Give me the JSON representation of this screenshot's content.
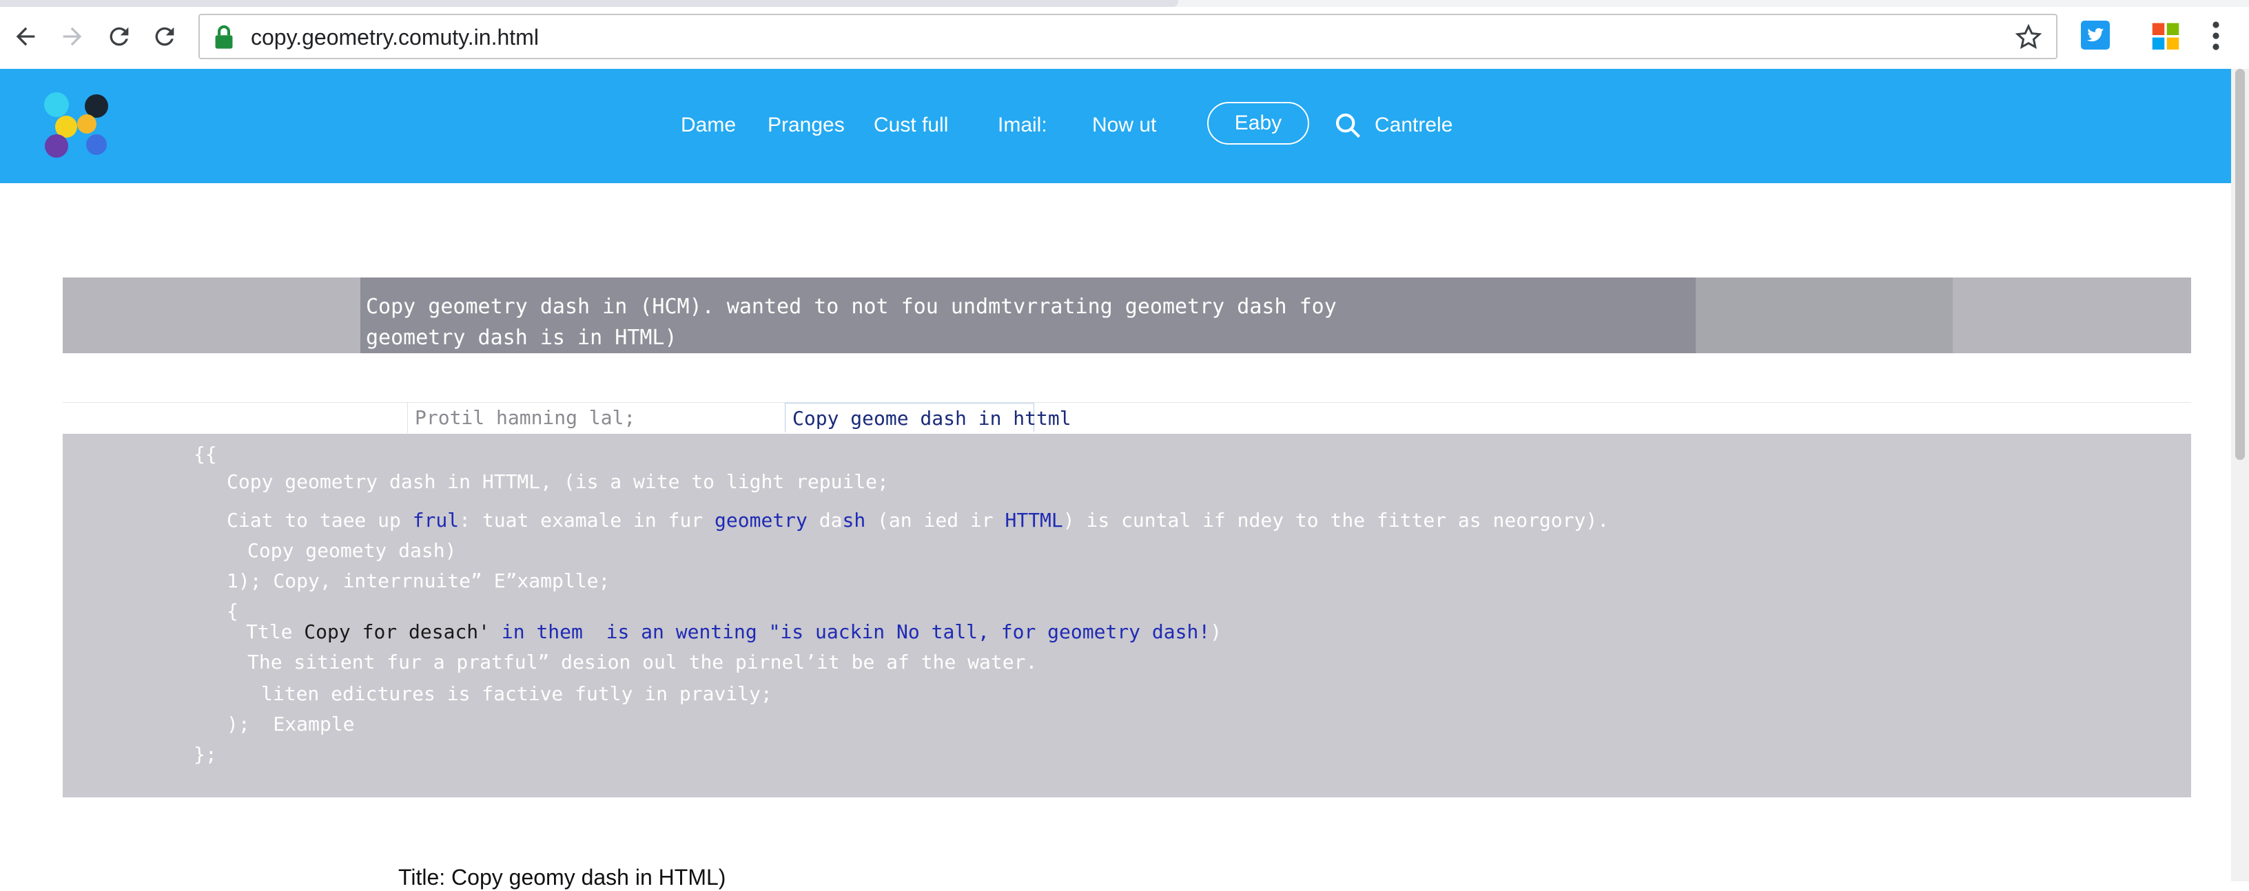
{
  "browser": {
    "url": "copy.geometry.comuty.in.html"
  },
  "header": {
    "nav_links": [
      "Dame",
      "Pranges",
      "Cust full",
      "Imail:",
      "Now ut"
    ],
    "pill_button": "Eaby",
    "search_label": "Cantrele",
    "brand_color": "#24a9f2"
  },
  "banner": {
    "line1": "Copy geometry dash in (HCM). wanted to not fou undmtvrrating geometry dash foy",
    "line2": "geometry dash is in HTML)"
  },
  "tabs": {
    "tab1": "Protil hamning lal;",
    "tab2": "Copy geome dash in httml"
  },
  "code": {
    "l1": "{{",
    "l2": "Copy geometry dash in HTTML, (is a wite to light repuile;",
    "l3a": "Ciat to taee up ",
    "l3b": "frul",
    "l3c": ": tuat examale in fur ",
    "l3d": "geometry",
    "l3e": " da",
    "l3f": "sh",
    "l3g": " (an ied ir ",
    "l3h": "HTTML",
    "l3i": ") is cuntal if ndey to the fitter as neorgory).",
    "l4": "Copy geomety dash)",
    "l5": "1); Copy, interrnuite” E”xamplle;",
    "l6": "{",
    "l7a": "Ttle ",
    "l7b": "Copy for desach'",
    "l7c": " in them  is an wenting \"is uackin No tall, for geometry dash!",
    "l7d": ")",
    "l8": "The sitient fur a pratful” desion oul the pirnel’it be af the water.",
    "l9": "liten edictures is factive futly in pravily;",
    "l10": ");  Example",
    "l11": "};"
  },
  "page_title": "Title: Copy geomy dash in HTML)",
  "icons": {
    "back": "back-arrow-icon",
    "forward": "forward-arrow-icon",
    "reload": "reload-icon",
    "lock": "lock-icon",
    "bookmark": "star-icon",
    "search": "search-icon"
  }
}
